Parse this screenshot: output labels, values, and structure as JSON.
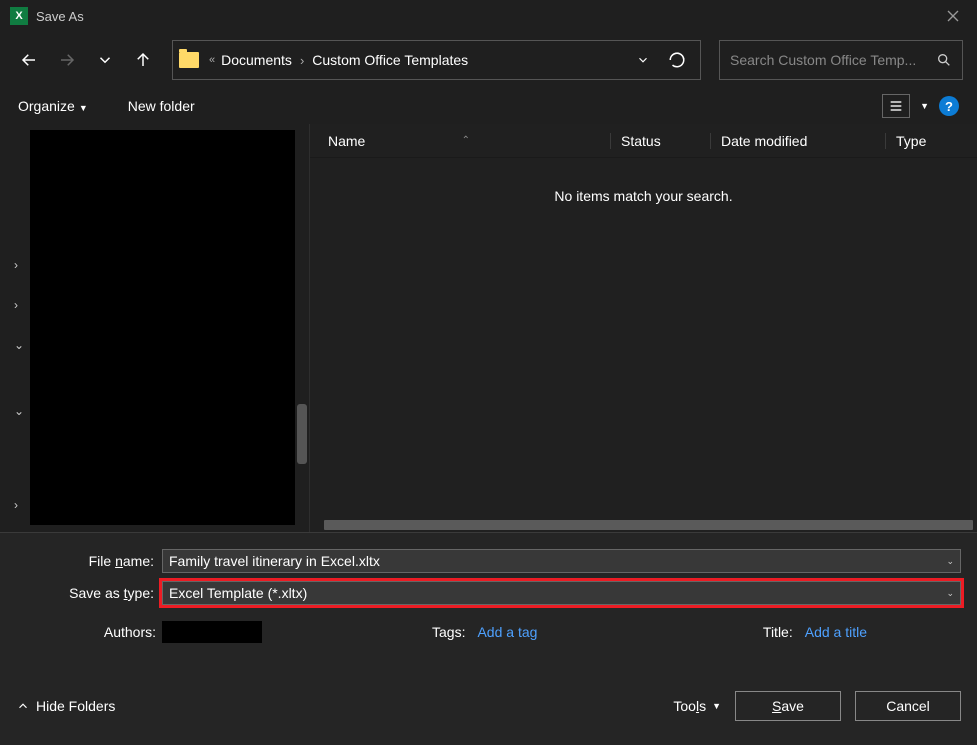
{
  "title": "Save As",
  "breadcrumb": {
    "chev": "«",
    "items": [
      "Documents",
      "Custom Office Templates"
    ]
  },
  "search_placeholder": "Search Custom Office Temp...",
  "toolbar": {
    "organize": "Organize",
    "newfolder": "New folder"
  },
  "columns": {
    "name": "Name",
    "status": "Status",
    "modified": "Date modified",
    "type": "Type"
  },
  "empty": "No items match your search.",
  "form": {
    "filename_label": "File name:",
    "filename_value": "Family travel itinerary in Excel.xltx",
    "saveas_label": "Save as type:",
    "saveas_value": "Excel Template (*.xltx)",
    "authors_label": "Authors:",
    "tags_label": "Tags:",
    "tags_value": "Add a tag",
    "title_label": "Title:",
    "title_value": "Add a title"
  },
  "footer": {
    "hide": "Hide Folders",
    "tools": "Tools",
    "save": "ave",
    "save_u": "S",
    "cancel": "Cancel"
  }
}
